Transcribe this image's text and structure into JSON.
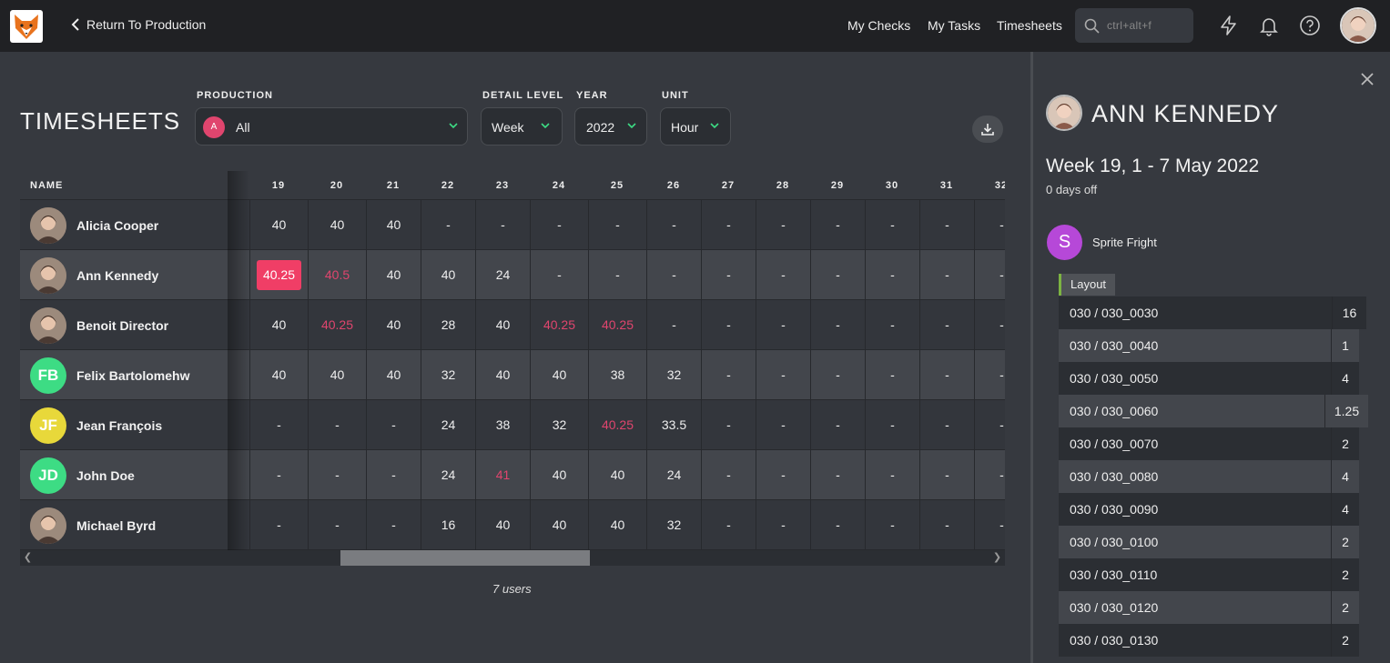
{
  "topbar": {
    "back_label": "Return To Production",
    "nav": [
      "My Checks",
      "My Tasks",
      "Timesheets"
    ],
    "search_placeholder": "ctrl+alt+f"
  },
  "page": {
    "title": "TIMESHEETS",
    "filters": {
      "production_label": "PRODUCTION",
      "production_value": "All",
      "production_initial": "A",
      "detail_label": "DETAIL LEVEL",
      "detail_value": "Week",
      "year_label": "YEAR",
      "year_value": "2022",
      "unit_label": "UNIT",
      "unit_value": "Hour"
    }
  },
  "table": {
    "name_header": "NAME",
    "weeks": [
      "19",
      "20",
      "21",
      "22",
      "23",
      "24",
      "25",
      "26",
      "27",
      "28",
      "29",
      "30",
      "31",
      "32"
    ],
    "rows": [
      {
        "name": "Alicia Cooper",
        "initials": "",
        "avatar": "photo",
        "values": [
          "40",
          "40",
          "40",
          "-",
          "-",
          "-",
          "-",
          "-",
          "-",
          "-",
          "-",
          "-",
          "-",
          "-"
        ],
        "warn": []
      },
      {
        "name": "Ann Kennedy",
        "initials": "",
        "avatar": "photo",
        "values": [
          "40.25",
          "40.5",
          "40",
          "40",
          "24",
          "-",
          "-",
          "-",
          "-",
          "-",
          "-",
          "-",
          "-",
          "-"
        ],
        "warn": [
          1
        ],
        "selected": 0
      },
      {
        "name": "Benoit Director",
        "initials": "",
        "avatar": "photo",
        "values": [
          "40",
          "40.25",
          "40",
          "28",
          "40",
          "40.25",
          "40.25",
          "-",
          "-",
          "-",
          "-",
          "-",
          "-",
          "-"
        ],
        "warn": [
          1,
          5,
          6
        ]
      },
      {
        "name": "Felix Bartolomehw",
        "initials": "FB",
        "avatar": "#3ddc84",
        "values": [
          "40",
          "40",
          "40",
          "32",
          "40",
          "40",
          "38",
          "32",
          "-",
          "-",
          "-",
          "-",
          "-",
          "-"
        ],
        "warn": []
      },
      {
        "name": "Jean François",
        "initials": "JF",
        "avatar": "#e8d83a",
        "values": [
          "-",
          "-",
          "-",
          "24",
          "38",
          "32",
          "40.25",
          "33.5",
          "-",
          "-",
          "-",
          "-",
          "-",
          "-"
        ],
        "warn": [
          6
        ]
      },
      {
        "name": "John Doe",
        "initials": "JD",
        "avatar": "#3ddc84",
        "values": [
          "-",
          "-",
          "-",
          "24",
          "41",
          "40",
          "40",
          "24",
          "-",
          "-",
          "-",
          "-",
          "-",
          "-"
        ],
        "warn": [
          4
        ]
      },
      {
        "name": "Michael Byrd",
        "initials": "",
        "avatar": "photo",
        "values": [
          "-",
          "-",
          "-",
          "16",
          "40",
          "40",
          "40",
          "32",
          "-",
          "-",
          "-",
          "-",
          "-",
          "-"
        ],
        "warn": []
      }
    ],
    "footer": "7 users"
  },
  "panel": {
    "person_name": "ANN KENNEDY",
    "week_title": "Week 19, 1 - 7 May 2022",
    "days_off": "0 days off",
    "production_initial": "S",
    "production_name": "Sprite Fright",
    "task_type": "Layout",
    "tasks": [
      {
        "name": "030 / 030_0030",
        "value": "16"
      },
      {
        "name": "030 / 030_0040",
        "value": "1"
      },
      {
        "name": "030 / 030_0050",
        "value": "4"
      },
      {
        "name": "030 / 030_0060",
        "value": "1.25"
      },
      {
        "name": "030 / 030_0070",
        "value": "2"
      },
      {
        "name": "030 / 030_0080",
        "value": "4"
      },
      {
        "name": "030 / 030_0090",
        "value": "4"
      },
      {
        "name": "030 / 030_0100",
        "value": "2"
      },
      {
        "name": "030 / 030_0110",
        "value": "2"
      },
      {
        "name": "030 / 030_0120",
        "value": "2"
      },
      {
        "name": "030 / 030_0130",
        "value": "2"
      }
    ]
  },
  "colors": {
    "accent_green": "#3ddc84",
    "warn": "#e0456e",
    "highlight": "#f03e66",
    "production": "#b648d8"
  }
}
